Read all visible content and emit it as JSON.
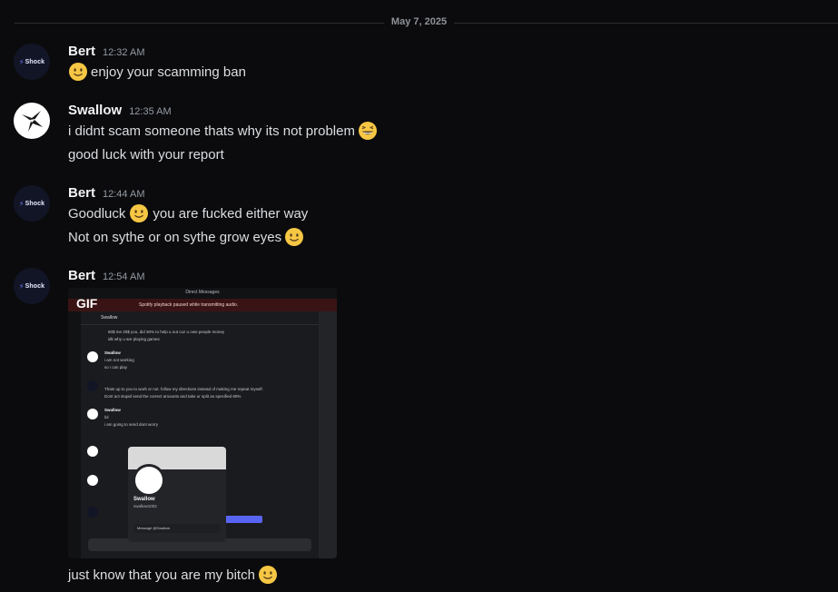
{
  "date_divider": "May 7, 2025",
  "messages": [
    {
      "author": "Bert",
      "avatar": "shock-logo",
      "avatar_text": "Shock",
      "time": "12:32 AM",
      "lines": [
        {
          "emoji": "slight-smile",
          "text": "enjoy your scamming ban"
        }
      ]
    },
    {
      "author": "Swallow",
      "avatar": "swallow-bird",
      "time": "12:35 AM",
      "lines": [
        {
          "text": "i didnt scam someone thats why its not problem",
          "emoji_after": "grinning-squint"
        },
        {
          "text": "good luck with your report"
        }
      ]
    },
    {
      "author": "Bert",
      "avatar": "shock-logo",
      "avatar_text": "Shock",
      "time": "12:44 AM",
      "lines": [
        {
          "text_before": "Goodluck",
          "emoji": "slight-smile",
          "text": "you are fucked either way"
        },
        {
          "text": "Not on sythe or on sythe grow eyes",
          "emoji_after": "slight-smile"
        }
      ]
    },
    {
      "author": "Bert",
      "avatar": "shock-logo",
      "avatar_text": "Shock",
      "time": "12:54 AM",
      "attachment": {
        "badge": "GIF",
        "window_title": "Direct Messages",
        "banner_text": "Spotify playback paused while transmitting audio.",
        "channel": "Swallow",
        "lines": [
          "60$ me 20$ you, did 30% to help u out cuz u owe people money",
          "idk why u are playing games",
          "i am not working",
          "so i can play",
          "Thats up to you to work or not. follow my directions instead of making me repeat myself.",
          "Dont act stupid send the correct amounts and take ur split as specified 80%",
          "lol",
          "i am going to send dont worry"
        ],
        "popup_name": "Swallow",
        "popup_sub": "swallow1002",
        "input_placeholder": "Message @Swallow"
      },
      "lines": [
        {
          "text": "just know that you are my bitch",
          "emoji_after": "slight-smile"
        }
      ]
    }
  ]
}
